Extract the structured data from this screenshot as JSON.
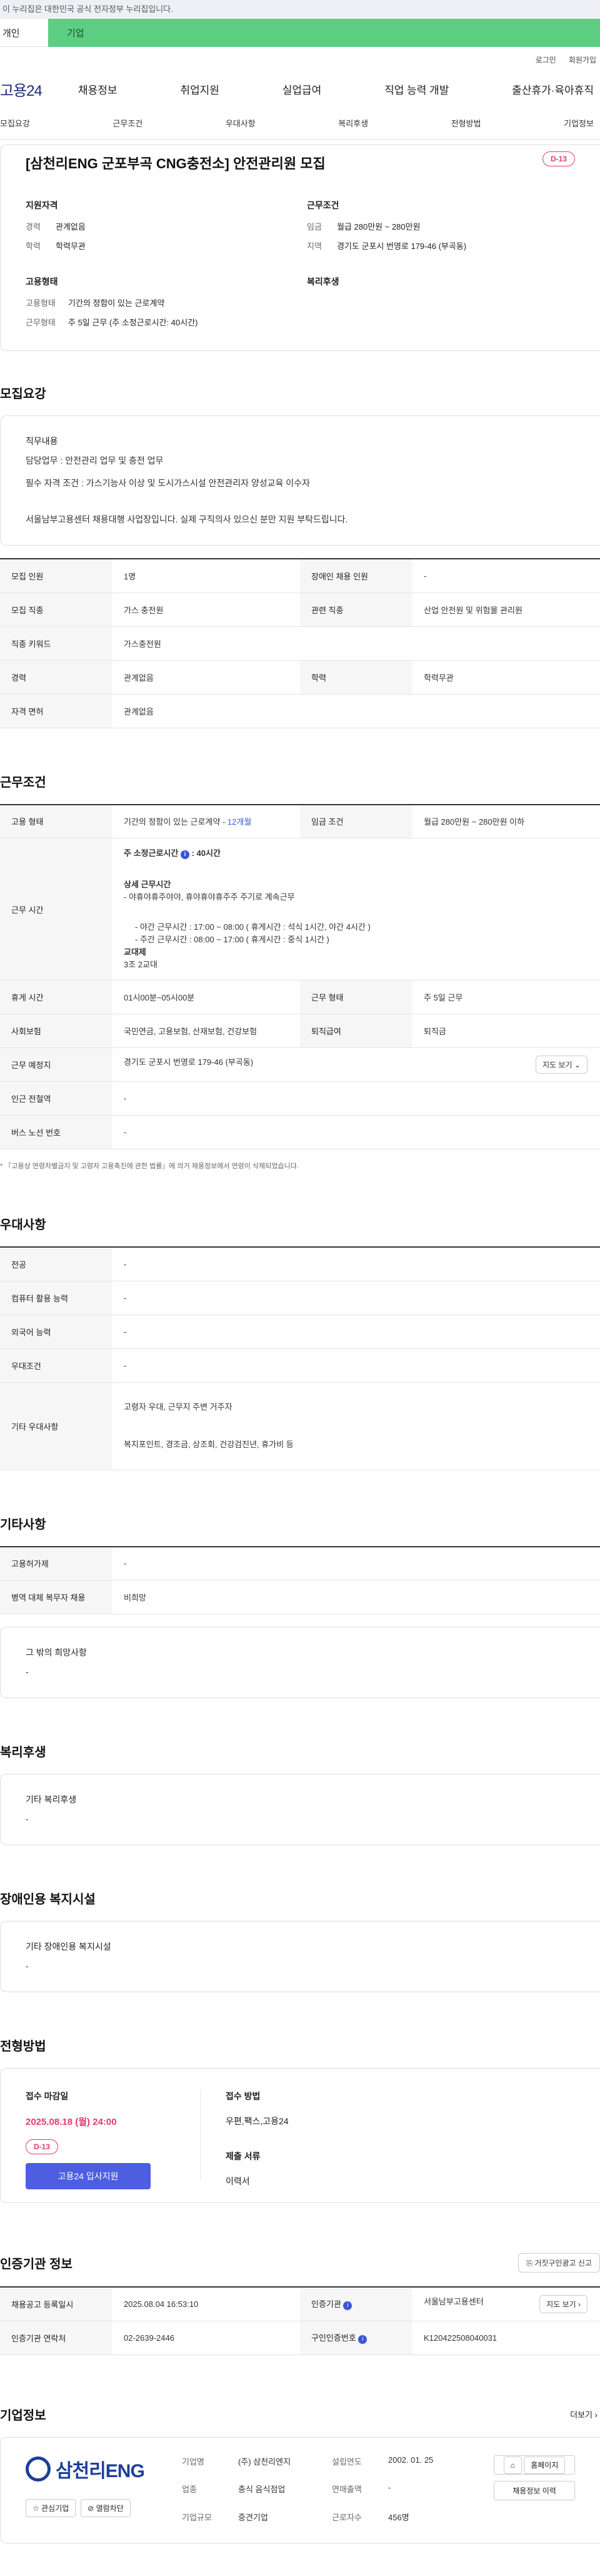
{
  "gov_banner": "이 누리집은 대한민국 공식 전자정부 누리집입니다.",
  "user_tabs": {
    "personal": "개인",
    "company": "기업"
  },
  "util_links": [
    "로그인",
    "회원가입"
  ],
  "logo": "고용24",
  "gnb": [
    "채용정보",
    "취업지원",
    "실업급여",
    "직업 능력 개발",
    "출산휴가·육아휴직"
  ],
  "anchor_nav": [
    "모집요강",
    "근무조건",
    "우대사항",
    "복리후생",
    "전형방법",
    "기업정보"
  ],
  "summary": {
    "title": "[삼천리ENG 군포부곡 CNG충전소] 안전관리원 모집",
    "dday": "D-13",
    "qualification": {
      "heading": "지원자격",
      "rows": [
        {
          "k": "경력",
          "v": "관계없음"
        },
        {
          "k": "학력",
          "v": "학력무관"
        }
      ]
    },
    "conditions": {
      "heading": "근무조건",
      "rows": [
        {
          "k": "임금",
          "v": "월급 280만원 ~ 280만원"
        },
        {
          "k": "지역",
          "v": "경기도 군포시 번영로 179-46 (부곡동)"
        }
      ]
    },
    "employment": {
      "heading": "고용형태",
      "rows": [
        {
          "k": "고용형태",
          "v": "기간의 정함이 있는 근로계약"
        },
        {
          "k": "근무형태",
          "v": "주 5일 근무 (주 소정근로시간: 40시간)"
        }
      ]
    },
    "welfare": {
      "heading": "복리후생"
    }
  },
  "recruit": {
    "title": "모집요강",
    "duty_heading": "직무내용",
    "lines": [
      "담당업무 : 안전관리 업무 및 충전 업무",
      "필수 자격 조건 : 가스기능사 이상 및 도시가스시설 안전관리자 양성교육 이수자",
      "서울남부고용센터 채용대행 사업장입니다. 실제 구직의사 있으신 분만 지원 부탁드립니다."
    ],
    "table": [
      [
        "모집 인원",
        "1명",
        "장애인 채용 인원",
        "-"
      ],
      [
        "모집 직종",
        "가스 충전원",
        "관련 직종",
        "산업 안전원 및 위험물 관리원"
      ],
      [
        "직종 키워드",
        "가스충전원"
      ],
      [
        "경력",
        "관계없음",
        "학력",
        "학력무관"
      ],
      [
        "자격 면허",
        "관계없음"
      ]
    ]
  },
  "conditions_section": {
    "title": "근무조건",
    "employment_type_k": "고용 형태",
    "employment_type_v": "기간의 정함이 있는 근로계약 - ",
    "employment_type_link": "12개월",
    "wage_k": "임금 조건",
    "wage_v": "월급 280만원 ~ 280만원 이하",
    "worktime_k": "근무 시간",
    "worktime_hl_label": "주 소정근로시간",
    "worktime_hl_badge": "i",
    "worktime_hl_value": ": 40시간",
    "worktime_detail_heading": "상세 근무시간",
    "worktime_lines": [
      "- 야휴야휴주야야, 휴야휴야휴주주 주기로 계속근무",
      "- 야간 근무시간 : 17:00 ~ 08:00 ( 휴게시간 : 석식 1시간, 야간 4시간 )",
      "- 주간 근무시간 : 08:00 ~ 17:00 ( 휴게시간 : 중식 1시간 )"
    ],
    "shift_heading": "교대제",
    "shift_value": "3조 2교대",
    "rows": [
      [
        "휴게 시간",
        "01시00분~05시00분",
        "근무 형태",
        "주 5일 근무"
      ],
      [
        "사회보험",
        "국민연금, 고용보험, 산재보험, 건강보험",
        "퇴직급여",
        "퇴직금"
      ]
    ],
    "location_k": "근무 예정지",
    "location_v": "경기도 군포시 번영로 179-46 (부곡동)",
    "map_btn": "지도 보기",
    "subway_k": "인근 전철역",
    "subway_v": "-",
    "bus_k": "버스 노선 번호",
    "bus_v": "-",
    "note": "* 『고용상 연령차별금지 및 고령자 고용촉진에 관한 법률』에 의거 채용정보에서 연령이 삭제되었습니다."
  },
  "preference": {
    "title": "우대사항",
    "rows": [
      [
        "전공",
        "-"
      ],
      [
        "컴퓨터 활용 능력",
        "-"
      ],
      [
        "외국어 능력",
        "-"
      ],
      [
        "우대조건",
        "-"
      ]
    ],
    "other_k": "기타 우대사항",
    "other_lines": [
      "고령자 우대, 근무지 주변 거주자",
      "복지포인트, 경조금, 상조회, 건강검진년, 휴가비 등"
    ]
  },
  "etc": {
    "title": "기타사항",
    "rows": [
      [
        "고용허가제",
        "-"
      ],
      [
        "병역 대체 복무자 채용",
        "비희망"
      ]
    ],
    "other_heading": "그 밖의 희망사항",
    "other_value": "-"
  },
  "welfare_section": {
    "title": "복리후생",
    "heading": "기타 복리후생",
    "value": "-"
  },
  "disability_section": {
    "title": "장애인용 복지시설",
    "heading": "기타 장애인용 복지시설",
    "value": "-"
  },
  "screening": {
    "title": "전형방법",
    "deadline_heading": "접수 마감일",
    "deadline": "2025.08.18 (월) 24:00",
    "dday": "D-13",
    "apply_btn": "고용24 입사지원",
    "method_heading": "접수 방법",
    "method": "우편,팩스,고용24",
    "docs_heading": "제출 서류",
    "docs": "이력서"
  },
  "cert": {
    "title": "인증기관 정보",
    "report_btn": "거짓구인광고 신고",
    "rows": [
      {
        "k1": "채용공고 등록일시",
        "v1": "2025.08.04 16:53:10",
        "k2": "인증기관",
        "v2": "서울남부고용센터",
        "btn": "지도 보기"
      },
      {
        "k1": "인증기관 연락처",
        "v1": "02-2639-2446",
        "k2": "구인인증번호",
        "v2": "K120422508040031"
      }
    ]
  },
  "company": {
    "title": "기업정보",
    "more": "더보기",
    "logo_text": "삼천리ENG",
    "interest_btn": "관심기업",
    "view_btn": "열람차단",
    "info": [
      {
        "k": "기업명",
        "v": "(주) 삼천리엔지"
      },
      {
        "k": "설립연도",
        "v": "2002. 01. 25"
      },
      {
        "k": "업종",
        "v": "충식 음식점업"
      },
      {
        "k": "연매출액",
        "v": "-"
      },
      {
        "k": "기업규모",
        "v": "중견기업"
      },
      {
        "k": "근로자수",
        "v": "456명"
      }
    ],
    "homepage_btn": "홈페이지",
    "jobinfo_btn": "채용정보 이력"
  }
}
